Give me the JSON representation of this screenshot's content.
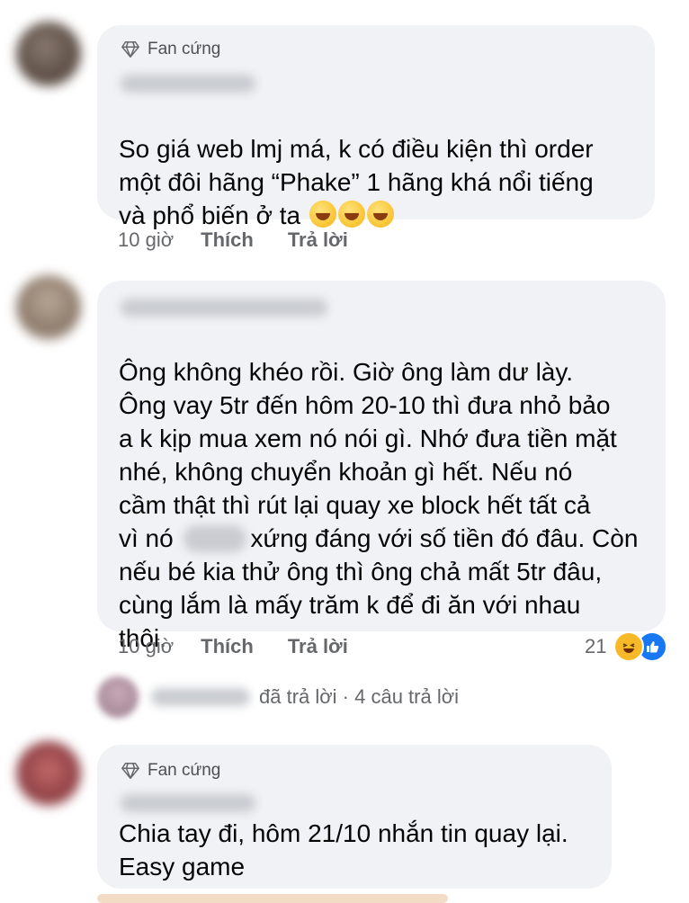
{
  "comments": [
    {
      "badge": "Fan cứng",
      "text": "So giá web lmj má, k có điều kiện thì order\nmột đôi  hãng “Phake” 1 hãng khá nổi tiếng\nvà phổ biến ở ta",
      "time": "10 giờ",
      "like": "Thích",
      "reply": "Trả lời"
    },
    {
      "text_part1": "Ông không khéo rồi. Giờ ông làm dư lày.\nÔng vay 5tr đến hôm 20-10 thì đưa nhỏ bảo\na k kịp mua xem nó nói gì. Nhớ đưa tiền mặt\nnhé, không chuyển khoản gì hết. Nếu nó\ncầm thật thì rút lại quay xe block hết tất cả\nvì nó ",
      "text_part2": "xứng đáng với số tiền đó đâu. Còn\nnếu bé kia thử ông thì ông chả mất 5tr đâu,\ncùng lắm là mấy trăm k để đi ăn với nhau\nthôi.",
      "time": "10 giờ",
      "like": "Thích",
      "reply": "Trả lời",
      "reaction_count": "21",
      "replies_summary": "đã trả lời · 4 câu trả lời"
    },
    {
      "badge": "Fan cứng",
      "text": "Chia tay đi, hôm 21/10 nhắn tin quay lại.\nEasy game"
    }
  ],
  "colors": {
    "bubble": "#f0f2f5",
    "meta": "#65676b",
    "like_blue": "#1877f2",
    "haha_yellow": "#f7b928"
  }
}
